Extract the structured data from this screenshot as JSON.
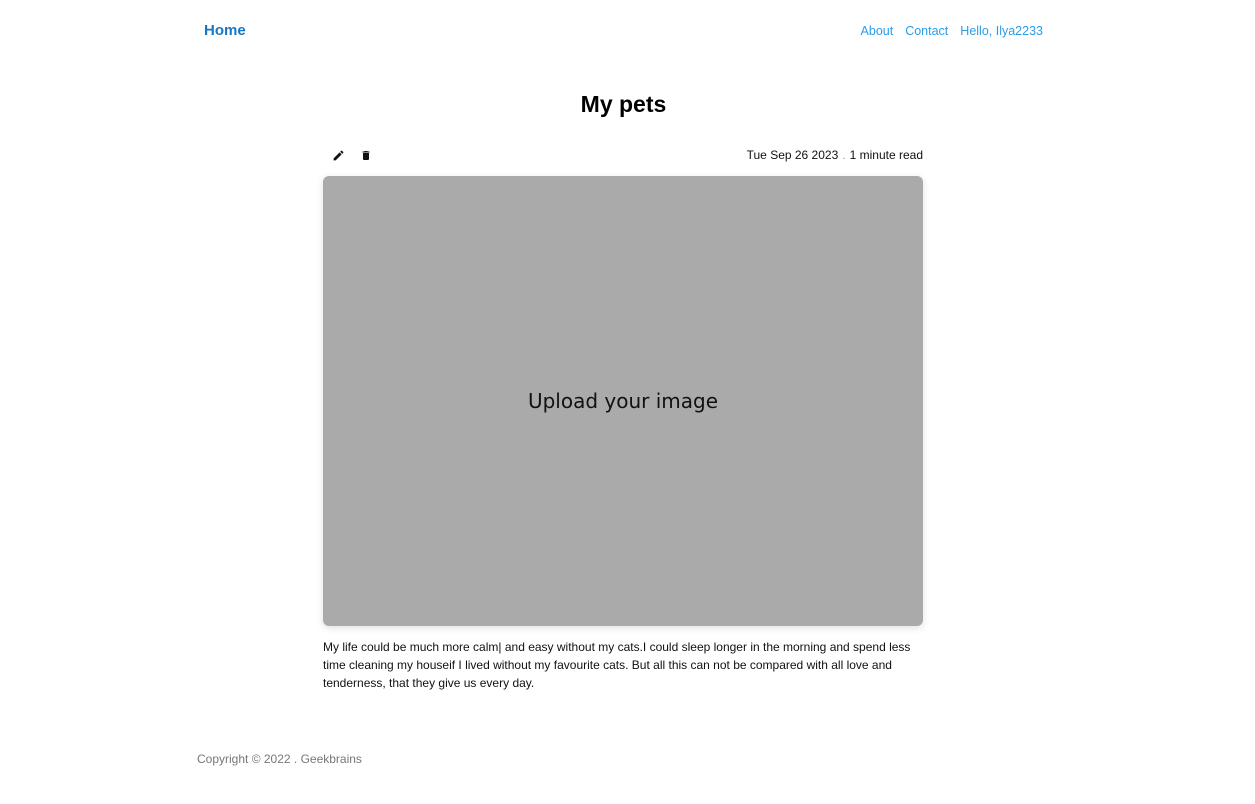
{
  "nav": {
    "home": "Home",
    "about": "About",
    "contact": "Contact",
    "greeting": "Hello, Ilya2233"
  },
  "page": {
    "title": "My pets"
  },
  "post": {
    "date": "Tue Sep 26 2023",
    "separator": ".",
    "read_time": "1 minute read",
    "image_placeholder": "Upload your image",
    "body": "My life could be much more calm| and easy without my cats.I could sleep longer in the morning and spend less time cleaning my houseif I lived without my favourite cats. But all this can not be compared with all love and tenderness, that they give us every day.",
    "actions": [
      {
        "icon": "pencil-icon"
      },
      {
        "icon": "trash-icon"
      }
    ]
  },
  "footer": {
    "copyright": "Copyright © 2022 . Geekbrains"
  },
  "colors": {
    "brand": "#1777c4",
    "link": "#2b9de8",
    "image_placeholder_bg": "#aaaaaa"
  }
}
